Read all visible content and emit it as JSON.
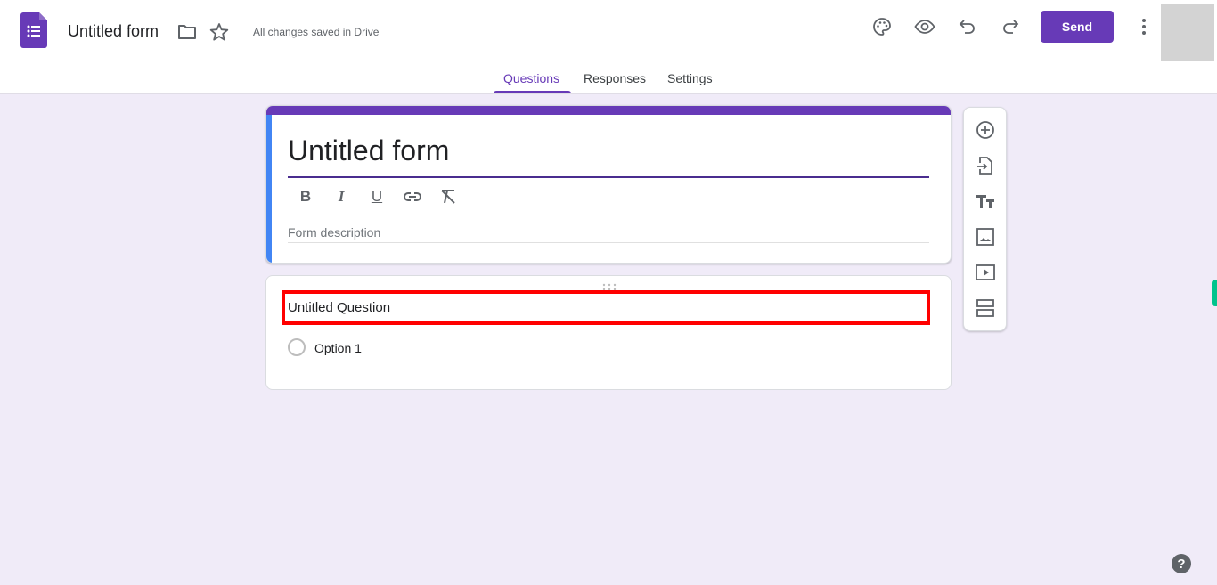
{
  "header": {
    "app_icon": "google-forms-icon",
    "title": "Untitled form",
    "folder_icon": "folder-icon",
    "star_icon": "star-icon",
    "save_status": "All changes saved in Drive",
    "actions": {
      "palette_icon": "palette-icon",
      "preview_icon": "eye-icon",
      "undo_icon": "undo-icon",
      "redo_icon": "redo-icon",
      "send_label": "Send",
      "more_icon": "more-vert-icon"
    }
  },
  "tabs": [
    {
      "label": "Questions",
      "active": true
    },
    {
      "label": "Responses",
      "active": false
    },
    {
      "label": "Settings",
      "active": false
    }
  ],
  "form": {
    "title": "Untitled form",
    "description_placeholder": "Form description",
    "format_tools": [
      "B",
      "I",
      "U",
      "link",
      "clear-format"
    ]
  },
  "question": {
    "title": "Untitled Question",
    "options": [
      "Option 1"
    ]
  },
  "toolbar": [
    {
      "name": "add-question",
      "icon": "add-circle-icon"
    },
    {
      "name": "import-questions",
      "icon": "import-icon"
    },
    {
      "name": "add-title",
      "icon": "text-title-icon"
    },
    {
      "name": "add-image",
      "icon": "image-icon"
    },
    {
      "name": "add-video",
      "icon": "video-icon"
    },
    {
      "name": "add-section",
      "icon": "section-icon"
    }
  ],
  "help_label": "?",
  "colors": {
    "accent": "#673ab7",
    "background": "#f0ebf8",
    "highlight": "#ff0000",
    "title_bar_left": "#4285f4"
  }
}
